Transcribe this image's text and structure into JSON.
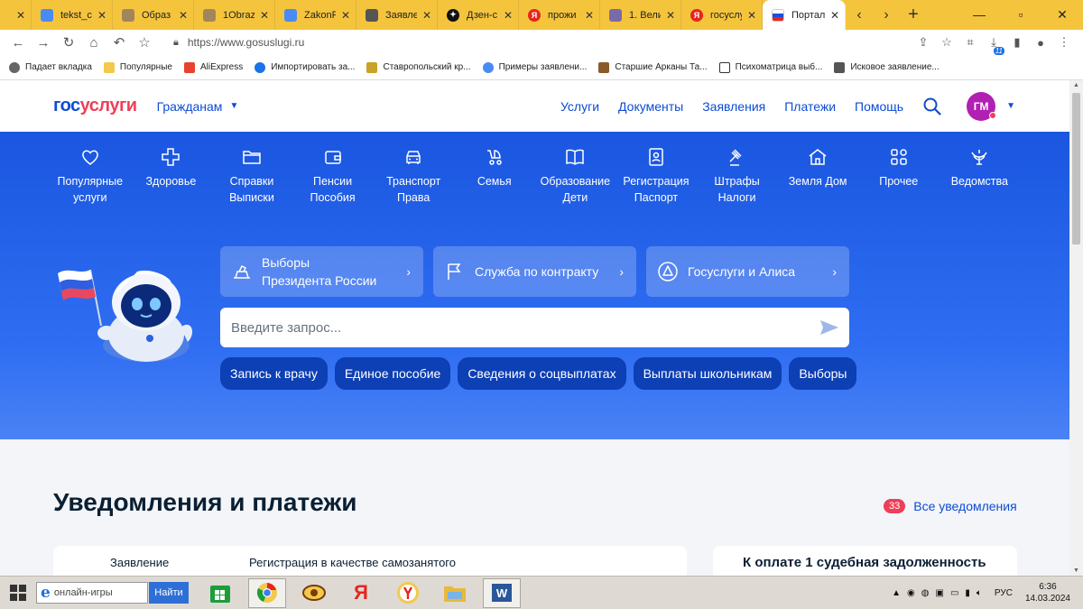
{
  "browser": {
    "tabs": [
      {
        "title": "",
        "color": "#888"
      },
      {
        "title": "tekst_c",
        "color": "#4a8af4"
      },
      {
        "title": "Образ",
        "color": "#a0865a"
      },
      {
        "title": "1Obraz",
        "color": "#a0865a"
      },
      {
        "title": "ZakonF",
        "color": "#4a8af4"
      },
      {
        "title": "Заявле",
        "color": "#555"
      },
      {
        "title": "Дзен-с",
        "color": "#111"
      },
      {
        "title": "прожи",
        "color": "#e5261f"
      },
      {
        "title": "1. Вели",
        "color": "#7a6aa8"
      },
      {
        "title": "госуслу",
        "color": "#e5261f"
      },
      {
        "title": "Портал",
        "color": "#ffffff"
      }
    ],
    "url": "https://www.gosuslugi.ru",
    "extension_badge": "11",
    "bookmarks": [
      {
        "label": "Падает вкладка",
        "color": "#666"
      },
      {
        "label": "Популярные",
        "color": "#f2c94c"
      },
      {
        "label": "AliExpress",
        "color": "#e8432e"
      },
      {
        "label": "Импортировать за...",
        "color": "#1a73e8"
      },
      {
        "label": "Ставропольский кр...",
        "color": "#c9a227"
      },
      {
        "label": "Примеры заявлени...",
        "color": "#4a8af4"
      },
      {
        "label": "Старшие Арканы Та...",
        "color": "#8a5a2b"
      },
      {
        "label": "Психоматрица выб...",
        "color": "#333"
      },
      {
        "label": "Исковое заявление...",
        "color": "#555"
      }
    ]
  },
  "header": {
    "logo_part1": "гос",
    "logo_part2": "услуги",
    "audience": "Гражданам",
    "nav": [
      "Услуги",
      "Документы",
      "Заявления",
      "Платежи",
      "Помощь"
    ],
    "avatar_initials": "ГМ"
  },
  "categories": [
    {
      "line1": "Популярные",
      "line2": "услуги",
      "icon": "heart-icon"
    },
    {
      "line1": "Здоровье",
      "line2": "",
      "icon": "plus-icon"
    },
    {
      "line1": "Справки",
      "line2": "Выписки",
      "icon": "folder-icon"
    },
    {
      "line1": "Пенсии",
      "line2": "Пособия",
      "icon": "wallet-icon"
    },
    {
      "line1": "Транспорт",
      "line2": "Права",
      "icon": "car-icon"
    },
    {
      "line1": "Семья",
      "line2": "",
      "icon": "stroller-icon"
    },
    {
      "line1": "Образование",
      "line2": "Дети",
      "icon": "book-icon"
    },
    {
      "line1": "Регистрация",
      "line2": "Паспорт",
      "icon": "id-card-icon"
    },
    {
      "line1": "Штрафы",
      "line2": "Налоги",
      "icon": "gavel-icon"
    },
    {
      "line1": "Земля Дом",
      "line2": "",
      "icon": "house-icon"
    },
    {
      "line1": "Прочее",
      "line2": "",
      "icon": "grid-icon"
    },
    {
      "line1": "Ведомства",
      "line2": "",
      "icon": "eagle-icon"
    }
  ],
  "quick_cards": [
    {
      "line1": "Выборы",
      "line2": "Президента России",
      "icon": "ballot-icon"
    },
    {
      "line1": "Служба по контракту",
      "line2": "",
      "icon": "flag-icon"
    },
    {
      "line1": "Госуслуги и Алиса",
      "line2": "",
      "icon": "alice-icon"
    }
  ],
  "search": {
    "placeholder": "Введите запрос..."
  },
  "chips": [
    "Запись к врачу",
    "Единое пособие",
    "Сведения о соцвыплатах",
    "Выплаты школьникам",
    "Выборы"
  ],
  "notifications": {
    "title": "Уведомления и платежи",
    "count": "33",
    "all_link": "Все уведомления",
    "card1_label": "Заявление",
    "card1_text": "Регистрация в качестве самозанятого",
    "card2_text": "К оплате 1 судебная задолженность"
  },
  "taskbar": {
    "search_text": "онлайн-игры",
    "go_button": "Найти",
    "lang": "РУС",
    "time": "6:36",
    "date": "14.03.2024"
  },
  "colors": {
    "brand_blue": "#0d4cd3",
    "brand_red": "#ee3f58",
    "hero": "#1a56e0"
  }
}
